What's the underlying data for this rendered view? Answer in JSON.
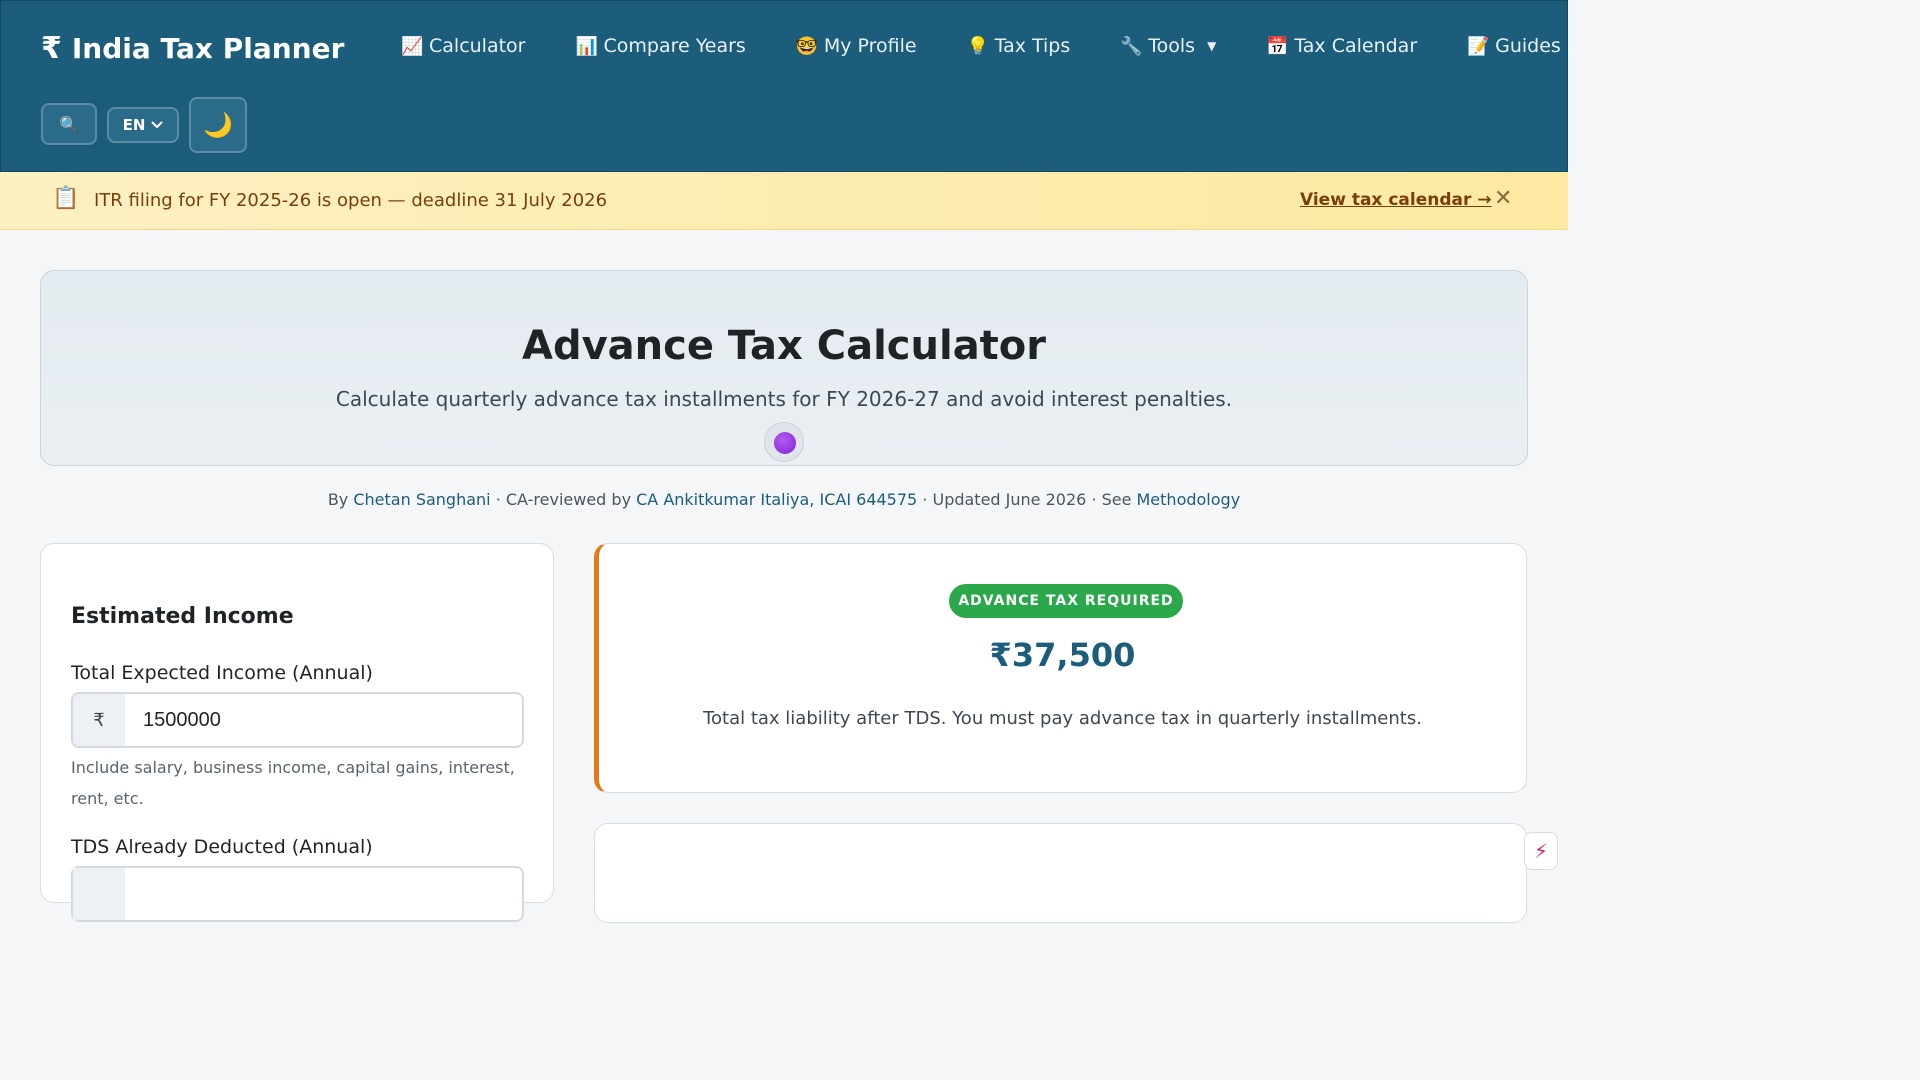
{
  "header": {
    "brand_symbol": "₹",
    "brand_name": "India Tax Planner",
    "nav": [
      {
        "icon": "📈",
        "label": "Calculator"
      },
      {
        "icon": "📊",
        "label": "Compare Years"
      },
      {
        "icon": "🤓",
        "label": "My Profile"
      },
      {
        "icon": "💡",
        "label": "Tax Tips"
      },
      {
        "icon": "🔧",
        "label": "Tools",
        "caret": "▼"
      },
      {
        "icon": "📅",
        "label": "Tax Calendar"
      },
      {
        "icon": "📝",
        "label": "Guides"
      }
    ],
    "search_icon": "🔍",
    "language": "EN",
    "theme_icon": "🌙"
  },
  "banner": {
    "icon": "📋",
    "text": "ITR filing for FY 2025-26 is open — deadline 31 July 2026",
    "link": "View tax calendar →",
    "close": "✕"
  },
  "hero": {
    "title": "Advance Tax Calculator",
    "subtitle": "Calculate quarterly advance tax installments for FY 2026-27 and avoid interest penalties."
  },
  "byline": {
    "by": "By ",
    "author": "Chetan Sanghani",
    "reviewed_prefix": " · CA-reviewed by ",
    "reviewer": "CA Ankitkumar Italiya, ICAI 644575",
    "updated": " · Updated June 2026 · See ",
    "methodology": "Methodology"
  },
  "income_card": {
    "heading": "Estimated Income",
    "income_label": "Total Expected Income (Annual)",
    "currency_prefix": "₹",
    "income_value": "1500000",
    "income_hint": "Include salary, business income, capital gains, interest, rent, etc.",
    "tds_label": "TDS Already Deducted (Annual)"
  },
  "result": {
    "badge": "ADVANCE TAX REQUIRED",
    "amount": "₹37,500",
    "description": "Total tax liability after TDS. You must pay advance tax in quarterly installments."
  },
  "floating_widget": {
    "label": "⚡"
  }
}
